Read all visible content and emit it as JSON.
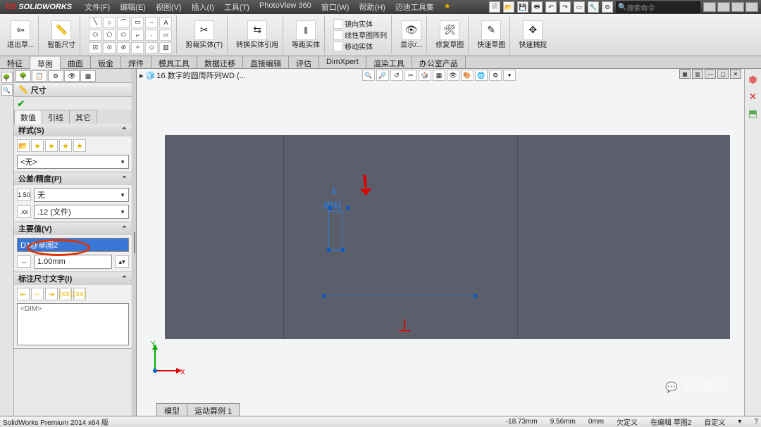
{
  "app": {
    "name": "SOLIDWORKS",
    "logo_accent": "DS"
  },
  "menu": [
    "文件(F)",
    "编辑(E)",
    "视图(V)",
    "插入(I)",
    "工具(T)",
    "PhotoView 360",
    "窗口(W)",
    "帮助(H)",
    "迈迪工具集"
  ],
  "search_placeholder": "搜索命令",
  "ribbon": {
    "exit": "退出草...",
    "smart_dim": "智能尺寸",
    "trim": "剪裁实体(T)",
    "convert": "转换实体引用",
    "offset": "等距实体",
    "mirror": "镜向实体",
    "linear": "线性草图阵列",
    "move": "移动实体",
    "display": "显示/...",
    "repair": "修复草图",
    "quick": "快速草图",
    "snap": "快速捕捉"
  },
  "tabs": [
    "特征",
    "草图",
    "曲面",
    "钣金",
    "焊件",
    "模具工具",
    "数据迁移",
    "直接编辑",
    "评估",
    "DimXpert",
    "渲染工具",
    "办公室产品"
  ],
  "active_tab": 1,
  "doc_title": "16.数字的圆周阵列WD  (...",
  "pm": {
    "title": "尺寸",
    "subtabs": [
      "数值",
      "引线",
      "其它"
    ],
    "active_sub": 0,
    "style": {
      "head": "样式(S)",
      "sel": "<无>"
    },
    "tol": {
      "head": "公差/精度(P)",
      "sel1": "无",
      "sel2": ".12 (文件)"
    },
    "main": {
      "head": "主要值(V)",
      "name": "D1@草图2",
      "val": "1.00mm"
    },
    "text": {
      "head": "标注尺寸文字(I)",
      "content": "<DIM>"
    }
  },
  "canvas": {
    "dim_num": "1",
    "dim_name": "(D1)"
  },
  "triad": {
    "x": "X",
    "y": "Y"
  },
  "btabs": [
    "模型",
    "运动算例 1"
  ],
  "status": {
    "product": "SolidWorks Premium 2014 x64 版",
    "x": "-18.73mm",
    "y": "9.56mm",
    "z": "0mm",
    "mode": "欠定义",
    "ctx": "在编辑  草图2",
    "custom": "自定义"
  },
  "watermark": "亦明图记"
}
